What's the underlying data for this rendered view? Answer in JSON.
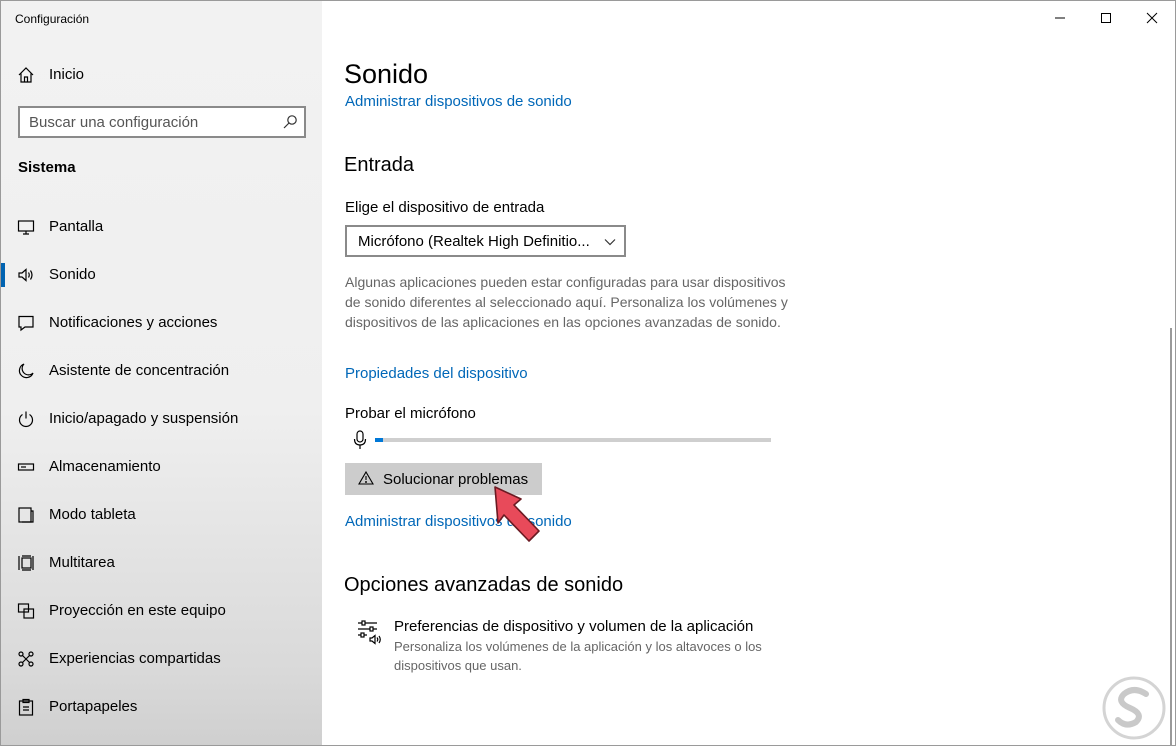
{
  "app": {
    "title": "Configuración"
  },
  "window_controls": {
    "minimize": "minimize-icon",
    "maximize": "maximize-icon",
    "close": "close-icon"
  },
  "sidebar": {
    "home_label": "Inicio",
    "search_placeholder": "Buscar una configuración",
    "section": "Sistema",
    "items": [
      {
        "label": "Pantalla",
        "icon": "monitor-icon"
      },
      {
        "label": "Sonido",
        "icon": "speaker-icon",
        "active": true
      },
      {
        "label": "Notificaciones y acciones",
        "icon": "notification-icon"
      },
      {
        "label": "Asistente de concentración",
        "icon": "moon-icon"
      },
      {
        "label": "Inicio/apagado y suspensión",
        "icon": "power-icon"
      },
      {
        "label": "Almacenamiento",
        "icon": "storage-icon"
      },
      {
        "label": "Modo tableta",
        "icon": "tablet-icon"
      },
      {
        "label": "Multitarea",
        "icon": "multitask-icon"
      },
      {
        "label": "Proyección en este equipo",
        "icon": "projection-icon"
      },
      {
        "label": "Experiencias compartidas",
        "icon": "share-icon"
      },
      {
        "label": "Portapapeles",
        "icon": "clipboard-icon"
      }
    ]
  },
  "main": {
    "title": "Sonido",
    "top_link": "Administrar dispositivos de sonido",
    "input_section": {
      "heading": "Entrada",
      "choose_label": "Elige el dispositivo de entrada",
      "device_selected": "Micrófono (Realtek High Definitio...",
      "description": "Algunas aplicaciones pueden estar configuradas para usar dispositivos de sonido diferentes al seleccionado aquí. Personaliza los volúmenes y dispositivos de las aplicaciones en las opciones avanzadas de sonido.",
      "properties_link": "Propiedades del dispositivo",
      "test_label": "Probar el micrófono",
      "mic_level": 0.02,
      "troubleshoot_button": "Solucionar problemas",
      "manage_link": "Administrar dispositivos de sonido"
    },
    "advanced": {
      "heading": "Opciones avanzadas de sonido",
      "item_title": "Preferencias de dispositivo y volumen de la aplicación",
      "item_desc": "Personaliza los volúmenes de la aplicación y los altavoces o los dispositivos que usan."
    }
  },
  "colors": {
    "accent": "#0078d7",
    "link": "#0067b8",
    "cursor": "#e84a5a"
  }
}
